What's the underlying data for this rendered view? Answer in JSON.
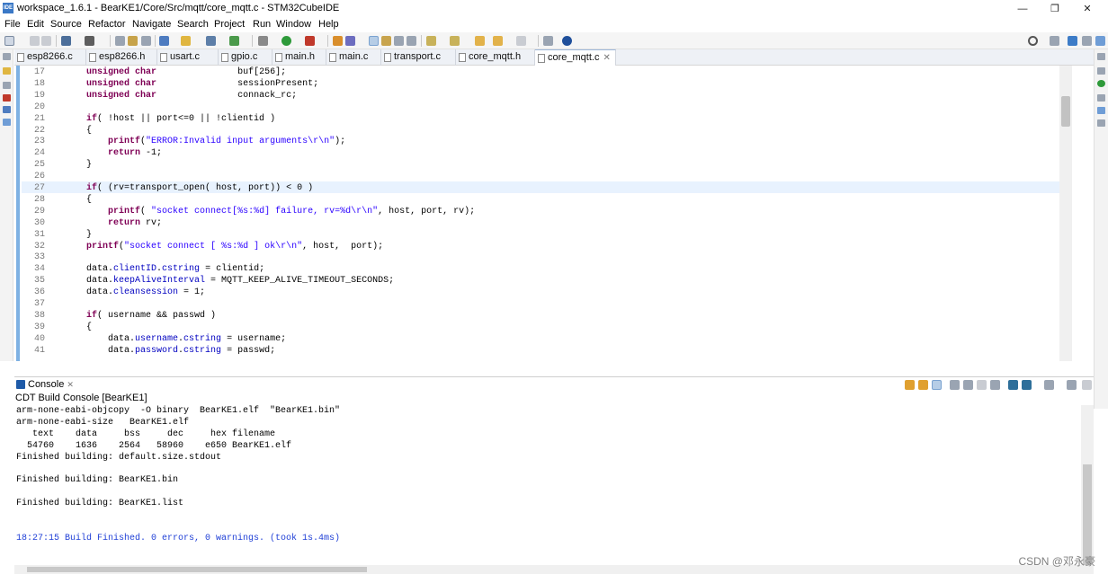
{
  "window": {
    "title": "workspace_1.6.1 - BearKE1/Core/Src/mqtt/core_mqtt.c - STM32CubeIDE",
    "app_icon_label": "IDE",
    "controls": {
      "minimize": "—",
      "maximize": "❐",
      "close": "✕"
    }
  },
  "menu": [
    "File",
    "Edit",
    "Source",
    "Refactor",
    "Navigate",
    "Search",
    "Project",
    "Run",
    "Window",
    "Help"
  ],
  "tabs": [
    {
      "label": "esp8266.c"
    },
    {
      "label": "esp8266.h"
    },
    {
      "label": "usart.c"
    },
    {
      "label": "gpio.c"
    },
    {
      "label": "main.h"
    },
    {
      "label": "main.c"
    },
    {
      "label": "transport.c"
    },
    {
      "label": "core_mqtt.h"
    },
    {
      "label": "core_mqtt.c",
      "close": "✕",
      "active": true
    }
  ],
  "editor": {
    "lines": [
      {
        "n": "17",
        "t": "    unsigned char               buf[256];"
      },
      {
        "n": "18",
        "t": "    unsigned char               sessionPresent;"
      },
      {
        "n": "19",
        "t": "    unsigned char               connack_rc;"
      },
      {
        "n": "20",
        "t": ""
      },
      {
        "n": "21",
        "t": "    if( !host || port<=0 || !clientid )"
      },
      {
        "n": "22",
        "t": "    {"
      },
      {
        "n": "23",
        "t": "        printf(\"ERROR:Invalid input arguments\\r\\n\");"
      },
      {
        "n": "24",
        "t": "        return -1;"
      },
      {
        "n": "25",
        "t": "    }"
      },
      {
        "n": "26",
        "t": ""
      },
      {
        "n": "27",
        "t": "    if( (rv=transport_open( host, port)) < 0 )"
      },
      {
        "n": "28",
        "t": "    {"
      },
      {
        "n": "29",
        "t": "        printf( \"socket connect[%s:%d] failure, rv=%d\\r\\n\", host, port, rv);"
      },
      {
        "n": "30",
        "t": "        return rv;"
      },
      {
        "n": "31",
        "t": "    }"
      },
      {
        "n": "32",
        "t": "    printf(\"socket connect [ %s:%d ] ok\\r\\n\", host,  port);"
      },
      {
        "n": "33",
        "t": ""
      },
      {
        "n": "34",
        "t": "    data.clientID.cstring = clientid;"
      },
      {
        "n": "35",
        "t": "    data.keepAliveInterval = MQTT_KEEP_ALIVE_TIMEOUT_SECONDS;"
      },
      {
        "n": "36",
        "t": "    data.cleansession = 1;"
      },
      {
        "n": "37",
        "t": ""
      },
      {
        "n": "38",
        "t": "    if( username && passwd )"
      },
      {
        "n": "39",
        "t": "    {"
      },
      {
        "n": "40",
        "t": "        data.username.cstring = username;"
      },
      {
        "n": "41",
        "t": "        data.password.cstring = passwd;"
      }
    ]
  },
  "console": {
    "tab_label": "Console",
    "tab_close": "✕",
    "subtitle": "CDT Build Console [BearKE1]",
    "lines": [
      "arm-none-eabi-objcopy  -O binary  BearKE1.elf  \"BearKE1.bin\"",
      "arm-none-eabi-size   BearKE1.elf",
      "   text    data     bss     dec     hex filename",
      "  54760    1636    2564   58960    e650 BearKE1.elf",
      "Finished building: default.size.stdout",
      "",
      "Finished building: BearKE1.bin",
      "",
      "Finished building: BearKE1.list",
      "",
      "",
      "18:27:15 Build Finished. 0 errors, 0 warnings. (took 1s.4ms)"
    ]
  },
  "watermark": "CSDN @邓永豪",
  "colors": {
    "accent": "#3a78c6",
    "keyword": "#7f0055",
    "string": "#2a00ff",
    "field": "#0000c0",
    "build_finished": "#1f3fd6"
  }
}
